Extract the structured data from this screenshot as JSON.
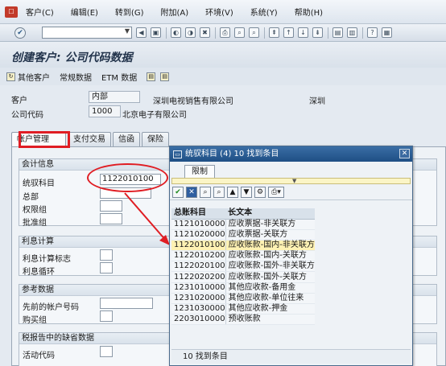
{
  "menubar": {
    "items": [
      "客户(C)",
      "编辑(E)",
      "转到(G)",
      "附加(A)",
      "环境(V)",
      "系统(Y)",
      "帮助(H)"
    ]
  },
  "toolbar": {
    "command_value": ""
  },
  "title": {
    "text": "创建客户: 公司代码数据"
  },
  "appbar": {
    "other_customer": "其他客户",
    "general_data": "常规数据",
    "etm_data": "ETM 数据"
  },
  "header": {
    "customer_label": "客户",
    "customer_value": "内部",
    "customer_name": "深圳电视销售有限公司",
    "customer_city": "深圳",
    "company_code_label": "公司代码",
    "company_code_value": "1000",
    "company_name": "北京电子有限公司"
  },
  "tabs": [
    "帐户管理",
    "支付交易",
    "信函",
    "保险"
  ],
  "groups": {
    "accounting_info": {
      "title": "会计信息",
      "fields": [
        "统驭科目",
        "总部",
        "权限组",
        "批准组"
      ],
      "recon_value": "1122010100"
    },
    "interest": {
      "title": "利息计算",
      "fields": [
        "利息计算标志",
        "利息循环"
      ]
    },
    "reference": {
      "title": "参考数据",
      "fields": [
        "先前的帐户号码",
        "购买组"
      ]
    },
    "tax": {
      "title": "税报告中的缺省数据",
      "fields": [
        "活动代码"
      ]
    }
  },
  "popup": {
    "title": "统驭科目 (4)   10 找到条目",
    "tab": "限制",
    "columns": [
      "总账科目",
      "长文本"
    ],
    "rows": [
      {
        "account": "1121010000",
        "text": "应收票据-非关联方"
      },
      {
        "account": "1121020000",
        "text": "应收票据-关联方"
      },
      {
        "account": "1122010100",
        "text": "应收账款-国内-非关联方"
      },
      {
        "account": "1122010200",
        "text": "应收账款-国内-关联方"
      },
      {
        "account": "1122020100",
        "text": "应收账款-国外-非关联方"
      },
      {
        "account": "1122020200",
        "text": "应收账款-国外-关联方"
      },
      {
        "account": "1231010000",
        "text": "其他应收款-备用金"
      },
      {
        "account": "1231020000",
        "text": "其他应收款-单位往来"
      },
      {
        "account": "1231030000",
        "text": "其他应收款-押金"
      },
      {
        "account": "2203010000",
        "text": "预收账款"
      }
    ],
    "selected_index": 2,
    "footer": "10 找到条目"
  },
  "colors": {
    "annotation": "#e01d23",
    "popup_title": "#1f4f85",
    "selected_row": "#fff2b3"
  }
}
